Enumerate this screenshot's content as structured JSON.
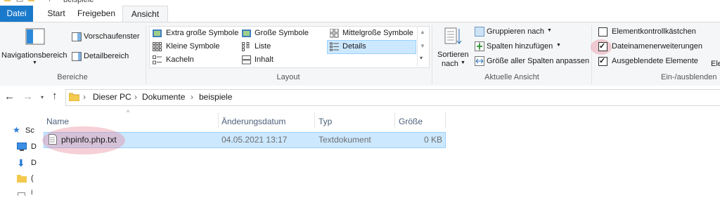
{
  "window": {
    "title": "beispiele"
  },
  "tabs": [
    {
      "label": "Datei"
    },
    {
      "label": "Start"
    },
    {
      "label": "Freigeben"
    },
    {
      "label": "Ansicht"
    }
  ],
  "ribbon": {
    "bereiche": {
      "group_label": "Bereiche",
      "nav_label": "Navigationsbereich",
      "preview_label": "Vorschaufenster",
      "details_label": "Detailbereich"
    },
    "layout": {
      "group_label": "Layout",
      "items": [
        {
          "label": "Extra große Symbole"
        },
        {
          "label": "Große Symbole"
        },
        {
          "label": "Mittelgroße Symbole"
        },
        {
          "label": "Kleine Symbole"
        },
        {
          "label": "Liste"
        },
        {
          "label": "Details"
        },
        {
          "label": "Kacheln"
        },
        {
          "label": "Inhalt"
        }
      ],
      "selected": "Details"
    },
    "current_view": {
      "group_label": "Aktuelle Ansicht",
      "sort_label_1": "Sortieren",
      "sort_label_2": "nach",
      "group_by": "Gruppieren nach",
      "add_columns": "Spalten hinzufügen",
      "fit_columns": "Größe aller Spalten anpassen"
    },
    "show_hide": {
      "group_label": "Ein-/ausblenden",
      "checkboxes": [
        {
          "label": "Elementkontrollkästchen",
          "checked": false
        },
        {
          "label": "Dateinamenerweiterungen",
          "checked": true
        },
        {
          "label": "Ausgeblendete Elemente",
          "checked": true
        }
      ],
      "cut_label": "Ele"
    }
  },
  "address": {
    "crumbs": [
      "Dieser PC",
      "Dokumente",
      "beispiele"
    ]
  },
  "columns": [
    "Name",
    "Änderungsdatum",
    "Typ",
    "Größe"
  ],
  "files": [
    {
      "name": "phpinfo.php.txt",
      "modified": "04.05.2021 13:17",
      "type": "Textdokument",
      "size": "0 KB"
    }
  ],
  "navpane": {
    "items": [
      {
        "label": "Sc",
        "icon": "star-icon"
      },
      {
        "label": "D",
        "icon": "desktop-icon"
      },
      {
        "label": "D",
        "icon": "download-icon"
      },
      {
        "label": "(",
        "icon": "folder-icon"
      },
      {
        "label": "I",
        "icon": "document-icon"
      }
    ]
  },
  "colors": {
    "accent": "#1979ca",
    "selection": "#cce8ff",
    "highlight": "#e6788c"
  }
}
